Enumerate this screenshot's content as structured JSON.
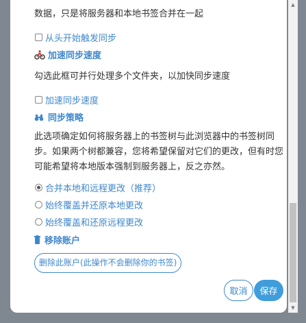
{
  "top_text": "数据，只是将服务器和本地书签合并在一起",
  "sync_from_scratch": {
    "label": "从头开始触发同步"
  },
  "speed_section": {
    "title": "加速同步速度",
    "icon": "bike-icon"
  },
  "speed_description": "勾选此框可并行处理多个文件夹，以加快同步速度",
  "speed_checkbox": {
    "label": "加速同步速度"
  },
  "strategy_section": {
    "title": "同步策略",
    "icon": "binoculars-icon"
  },
  "strategy_description": "此选项确定如何将服务器上的书签树与此浏览器中的书签树同步。如果两个树都兼容，您将希望保留对它们的更改，但有时您可能希望将本地版本强制到服务器上，反之亦然。",
  "strategy_options": [
    {
      "label": "合并本地和远程更改（推荐）",
      "checked": true
    },
    {
      "label": "始终覆盖并还原本地更改",
      "checked": false
    },
    {
      "label": "始终覆盖和还原远程更改",
      "checked": false
    }
  ],
  "remove_section": {
    "title": "移除账户",
    "icon": "trash-icon"
  },
  "remove_button": "删除此账户(此操作不会删除你的书签)",
  "footer": {
    "cancel": "取消",
    "save": "保存"
  },
  "colors": {
    "accent": "#3f87cc",
    "save_bg": "#3f9ddc",
    "backdrop": "#7f8791"
  },
  "scroll_arrows": {
    "up": "▲",
    "down": "▼"
  }
}
